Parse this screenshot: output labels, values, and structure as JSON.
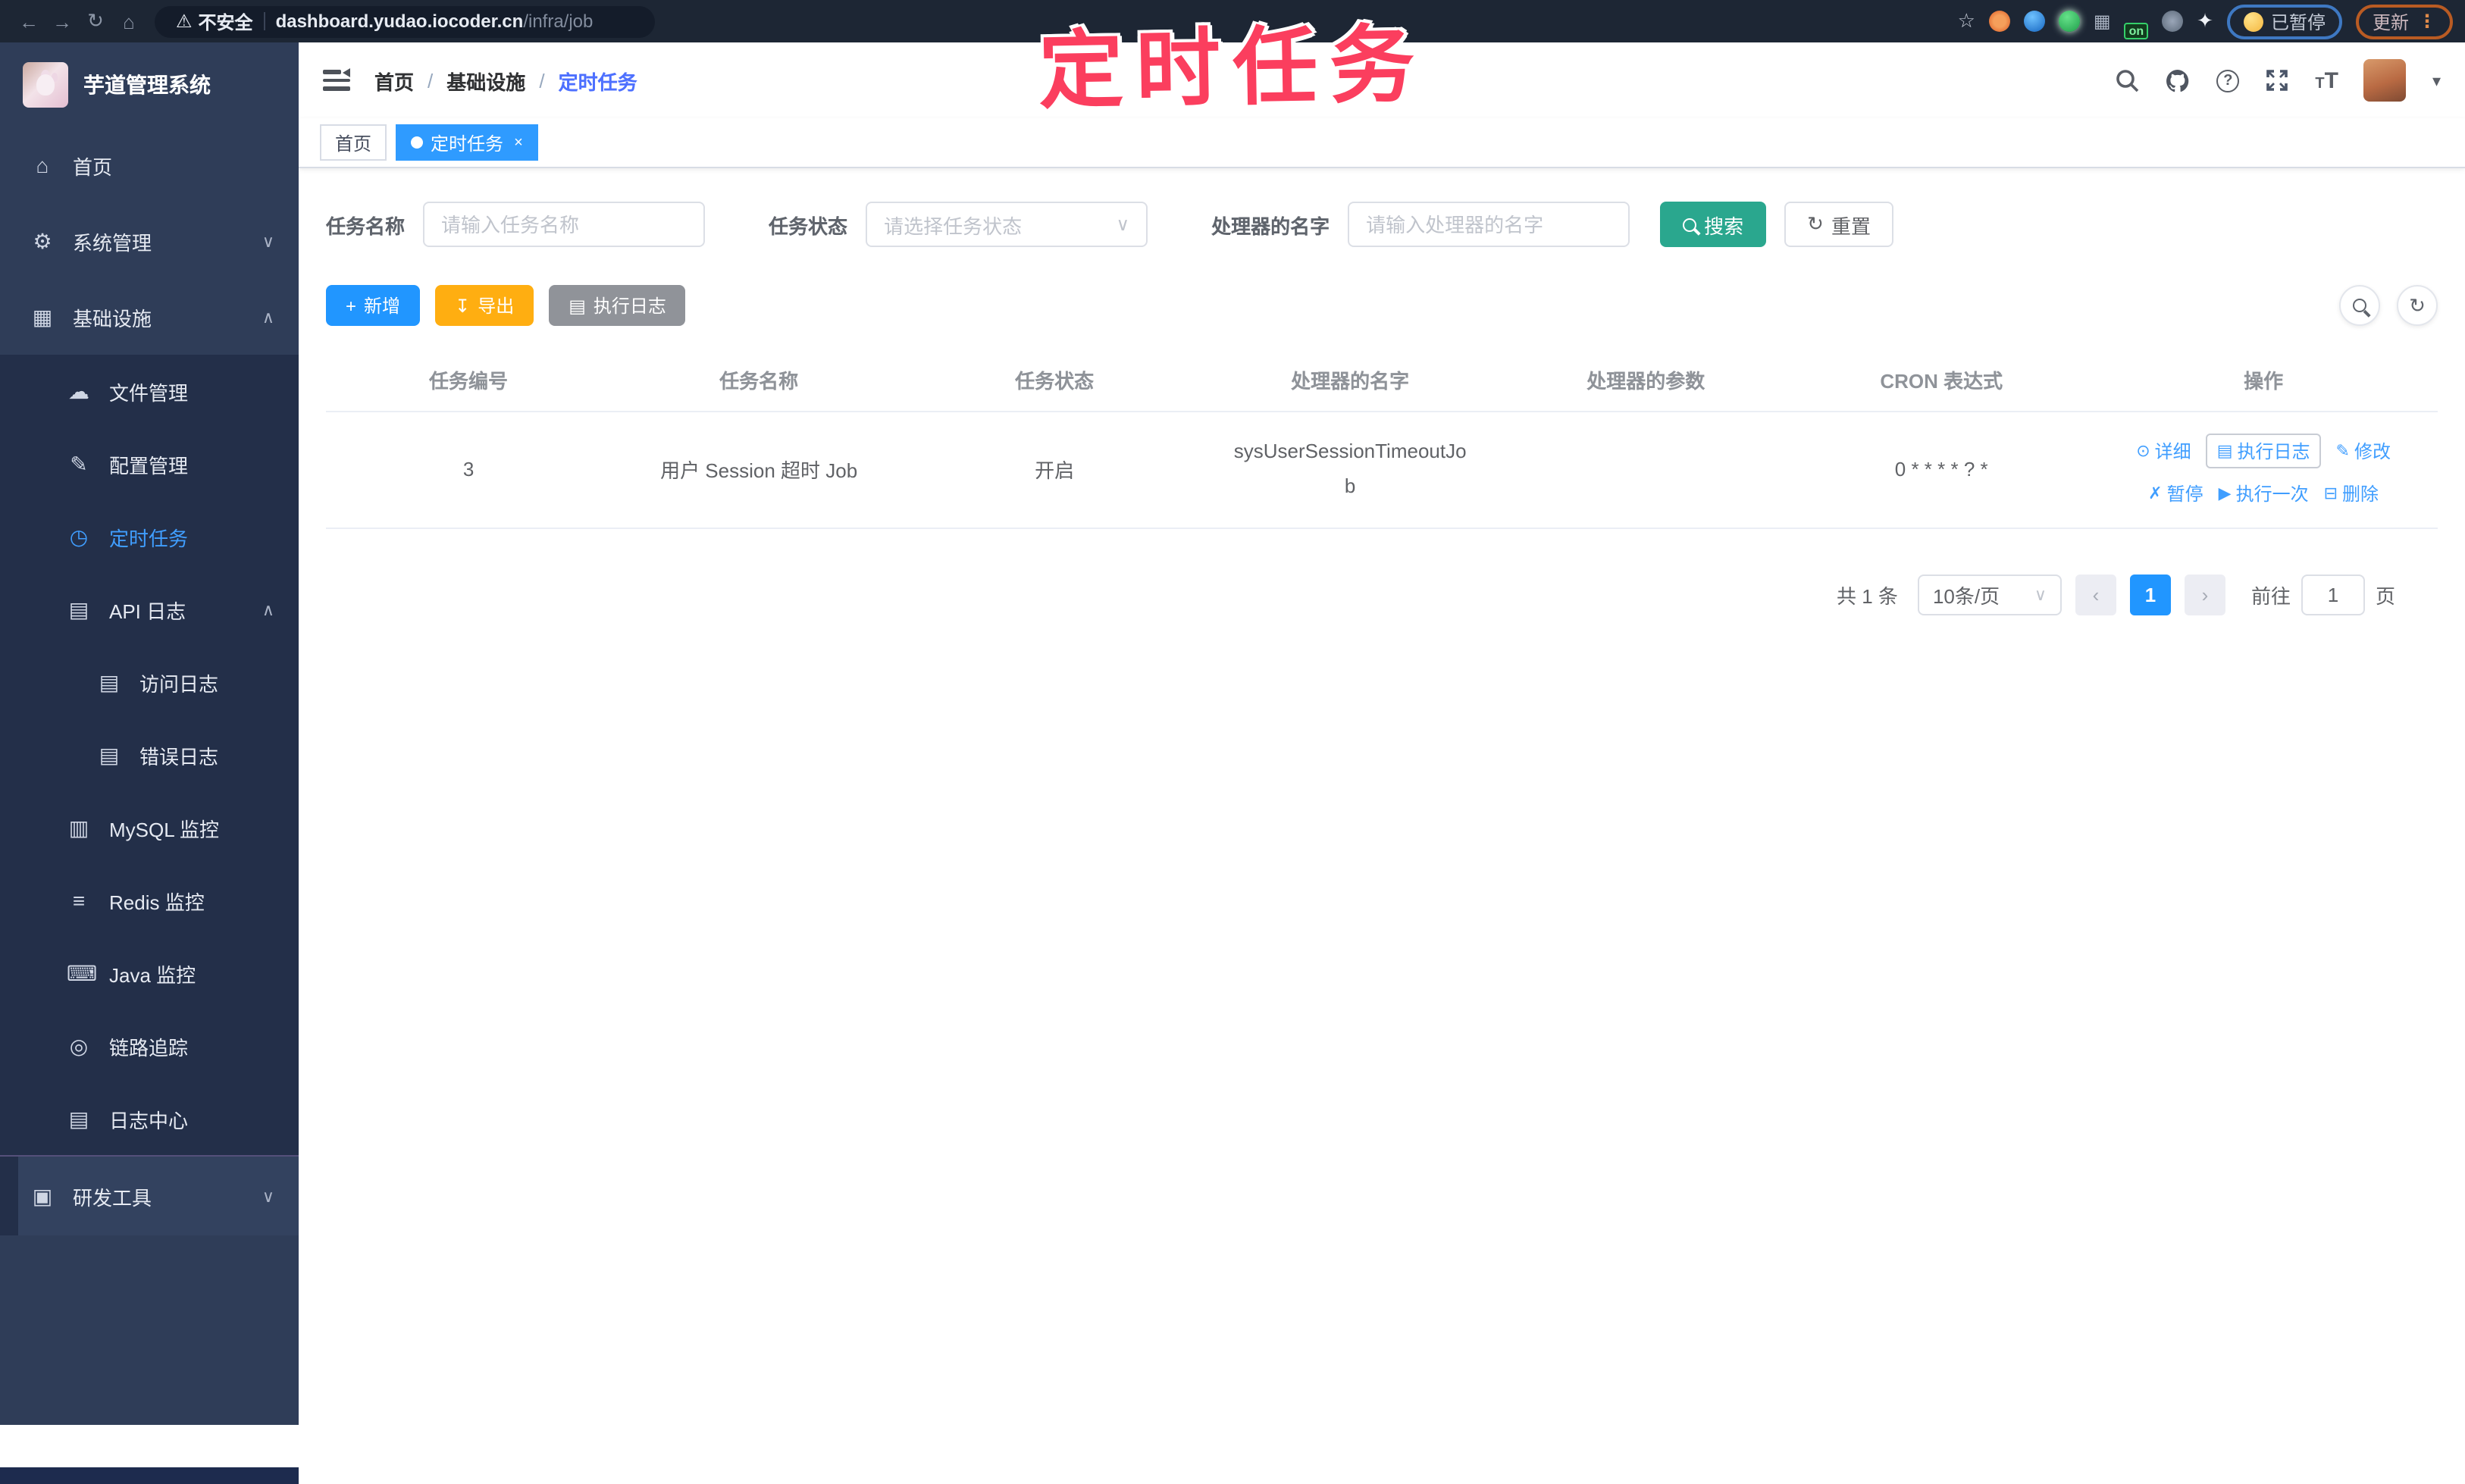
{
  "browser": {
    "security_label": "不安全",
    "url_host": "dashboard.yudao.iocoder.cn",
    "url_path": "/infra/job",
    "on_badge": "on",
    "paused_label": "已暂停",
    "update_label": "更新"
  },
  "annotation": {
    "text": "定时任务"
  },
  "icons": {
    "back": "←",
    "forward": "→",
    "reload": "↻",
    "home": "⌂",
    "warning": "⚠",
    "star": "☆",
    "grid": "▦",
    "pin": "✦",
    "dots": "⋮",
    "chevron_down": "∨",
    "chevron_up": "∧",
    "caret_down": "▾",
    "select_caret": "∨",
    "menu_home": "⌂",
    "menu_system": "⚙",
    "menu_infra": "▦",
    "menu_file": "☁",
    "menu_config": "✎",
    "menu_job": "◷",
    "menu_api": "▤",
    "menu_access": "▤",
    "menu_error": "▤",
    "menu_mysql": "▥",
    "menu_redis": "≡",
    "menu_java": "⌨",
    "menu_trace": "◎",
    "menu_logcenter": "▤",
    "menu_dev": "▣",
    "plus": "+",
    "download": "↧",
    "exec_log": "▤",
    "refresh": "↻",
    "detail": "⊙",
    "modify": "✎",
    "pause": "✗",
    "run_once": "▶",
    "delete": "⊟",
    "prev": "‹",
    "next": "›",
    "question": "?",
    "fontsize_big": "T",
    "fontsize_small": "T"
  },
  "sidebar": {
    "title": "芋道管理系统",
    "items": [
      {
        "label": "首页"
      },
      {
        "label": "系统管理"
      },
      {
        "label": "基础设施"
      },
      {
        "label": "文件管理"
      },
      {
        "label": "配置管理"
      },
      {
        "label": "定时任务"
      },
      {
        "label": "API 日志"
      },
      {
        "label": "访问日志"
      },
      {
        "label": "错误日志"
      },
      {
        "label": "MySQL 监控"
      },
      {
        "label": "Redis 监控"
      },
      {
        "label": "Java 监控"
      },
      {
        "label": "链路追踪"
      },
      {
        "label": "日志中心"
      },
      {
        "label": "研发工具"
      }
    ]
  },
  "header": {
    "breadcrumb": [
      "首页",
      "基础设施",
      "定时任务"
    ],
    "breadcrumb_sep": "/"
  },
  "tags": {
    "home": "首页",
    "active": "定时任务",
    "close": "×"
  },
  "filters": {
    "name_label": "任务名称",
    "name_placeholder": "请输入任务名称",
    "status_label": "任务状态",
    "status_placeholder": "请选择任务状态",
    "handler_label": "处理器的名字",
    "handler_placeholder": "请输入处理器的名字",
    "search_label": "搜索",
    "reset_label": "重置"
  },
  "toolbar": {
    "add_label": "新增",
    "export_label": "导出",
    "exec_log_label": "执行日志"
  },
  "table": {
    "headers": [
      "任务编号",
      "任务名称",
      "任务状态",
      "处理器的名字",
      "处理器的参数",
      "CRON 表达式",
      "操作"
    ],
    "rows": [
      {
        "id": "3",
        "name": "用户 Session 超时 Job",
        "status": "开启",
        "handler": "sysUserSessionTimeoutJob",
        "param": "",
        "cron": "0 * * * * ? *"
      }
    ],
    "actions": {
      "detail": "详细",
      "exec_log": "执行日志",
      "modify": "修改",
      "pause": "暂停",
      "run_once": "执行一次",
      "delete": "删除"
    }
  },
  "pagination": {
    "total": "共 1 条",
    "page_size": "10条/页",
    "current_page": "1",
    "goto_label": "前往",
    "goto_value": "1",
    "page_unit": "页"
  }
}
